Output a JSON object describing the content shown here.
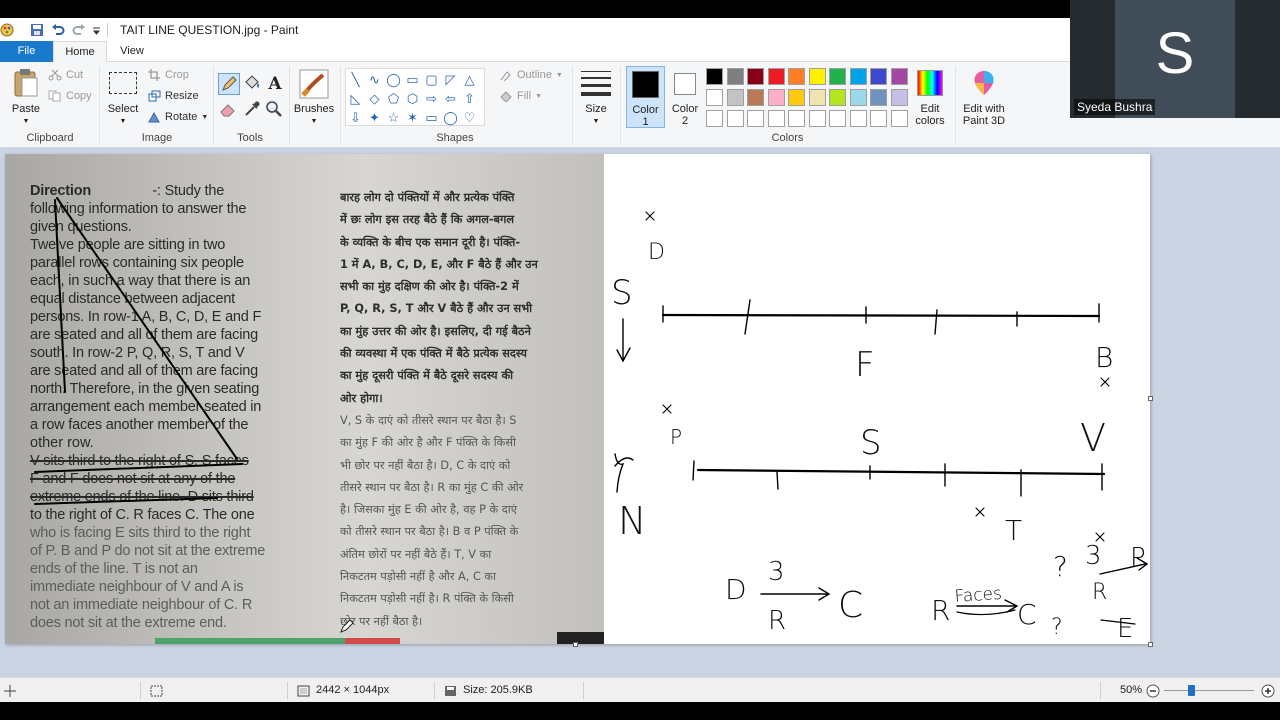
{
  "window": {
    "title": "TAIT LINE QUESTION.jpg - Paint"
  },
  "tabs": [
    {
      "label": "File"
    },
    {
      "label": "Home"
    },
    {
      "label": "View"
    }
  ],
  "ribbon": {
    "clipboard": {
      "paste": "Paste",
      "cut": "Cut",
      "copy": "Copy",
      "label": "Clipboard"
    },
    "image": {
      "select": "Select",
      "crop": "Crop",
      "resize": "Resize",
      "rotate": "Rotate",
      "label": "Image"
    },
    "tools": {
      "label": "Tools",
      "text_tool": "A"
    },
    "brushes": {
      "label": "Brushes"
    },
    "shapes": {
      "outline": "Outline",
      "fill": "Fill",
      "label": "Shapes"
    },
    "size": {
      "label": "Size"
    },
    "color1": {
      "label1": "Color",
      "label2": "1"
    },
    "color2": {
      "label1": "Color",
      "label2": "2"
    },
    "colors": {
      "label": "Colors",
      "edit1": "Edit",
      "edit2": "colors"
    },
    "paint3d": {
      "label1": "Edit with",
      "label2": "Paint 3D"
    }
  },
  "palette": {
    "row1": [
      "#000000",
      "#7f7f7f",
      "#880015",
      "#ed1c24",
      "#ff7f27",
      "#fff200",
      "#22b14c",
      "#00a2e8",
      "#3f48cc",
      "#a349a4"
    ],
    "row2": [
      "#ffffff",
      "#c3c3c3",
      "#b97a57",
      "#ffaec9",
      "#ffc90e",
      "#efe4b0",
      "#b5e61d",
      "#99d9ea",
      "#7092be",
      "#c8bfe7"
    ],
    "row3": [
      "#ffffff",
      "#ffffff",
      "#ffffff",
      "#ffffff",
      "#ffffff",
      "#ffffff",
      "#ffffff",
      "#ffffff",
      "#ffffff",
      "#ffffff"
    ],
    "color1": "#000000",
    "color2": "#ffffff"
  },
  "video": {
    "initial": "S",
    "name": "Syeda Bushra"
  },
  "photo": {
    "english_lines": [
      "Direction -: Study the",
      "following information to answer the",
      "given questions.",
      "Twelve people are sitting in two",
      "parallel rows containing six people",
      "each, in such a way that there is an",
      "equal distance between adjacent",
      "persons. In row-1 A, B, C, D, E and F",
      "are seated and all of them are facing",
      "south. In row-2 P, Q, R, S, T and V",
      "are seated and all of them are facing",
      "north. Therefore, in the given seating",
      "arrangement each member seated in",
      "a row faces another member of the",
      "other row.",
      "V sits third to the right of S. S faces",
      "F and F does not sit at any of the",
      "extreme ends of the line. D sits third",
      "to the right of C. R faces C. The one",
      "who is facing E sits third to the right",
      "of P. B and P do not sit at the extreme",
      "ends of the line. T is not an",
      "immediate neighbour of V and A is",
      "not an immediate neighbour of C. R",
      "does not sit at the extreme end."
    ],
    "hindi_lines": [
      "बारह लोग दो पंक्तियों में और प्रत्येक पंक्ति",
      "में छः लोग इस तरह बैठे हैं कि अगल-बगल",
      "के व्यक्ति के बीच एक समान दूरी है। पंक्ति-",
      "1 में A, B, C, D, E, और F बैठे हैं और उन",
      "सभी का मुंह दक्षिण की ओर है। पंक्ति-2 में",
      "P, Q, R, S, T और V बैठे हैं और उन सभी",
      "का मुंह उत्तर की ओर है। इसलिए, दी गई बैठने",
      "की व्यवस्था में एक पंक्ति में बैठे प्रत्येक सदस्य",
      "का मुंह दूसरी पंक्ति में बैठे दूसरे सदस्य की",
      "ओर होगा।",
      "V, S के दाएं को तीसरे स्थान पर बैठा है। S",
      "का मुंह F की ओर है और F पंक्ति के किसी",
      "भी छोर पर नहीं बैठा है। D, C के दाएं को",
      "तीसरे स्थान पर बैठा है। R का मुंह C की ओर",
      "है। जिसका मुंह E की ओर है, वह P के दाएं",
      "को तीसरे स्थान पर बैठा है। B व P पंक्ति के",
      "अंतिम छोरों पर नहीं बैठे हैं। T, V का",
      "निकटतम पड़ोसी नहीं है और A, C का",
      "निकटतम पड़ोसी नहीं है। R पंक्ति के किसी",
      "छोर पर नहीं बैठा है।"
    ]
  },
  "sketch": {
    "labels": [
      "D",
      "S",
      "F",
      "B",
      "P",
      "S",
      "V",
      "N",
      "T",
      "D",
      "3",
      "R",
      "C",
      "R",
      "Faces",
      "C",
      "3",
      "P",
      "R",
      "E",
      "?",
      "?"
    ]
  },
  "status": {
    "dimensions": "2442 × 1044px",
    "size": "Size: 205.9KB",
    "zoom": "50%",
    "zoom_slider_value": 0.5
  }
}
